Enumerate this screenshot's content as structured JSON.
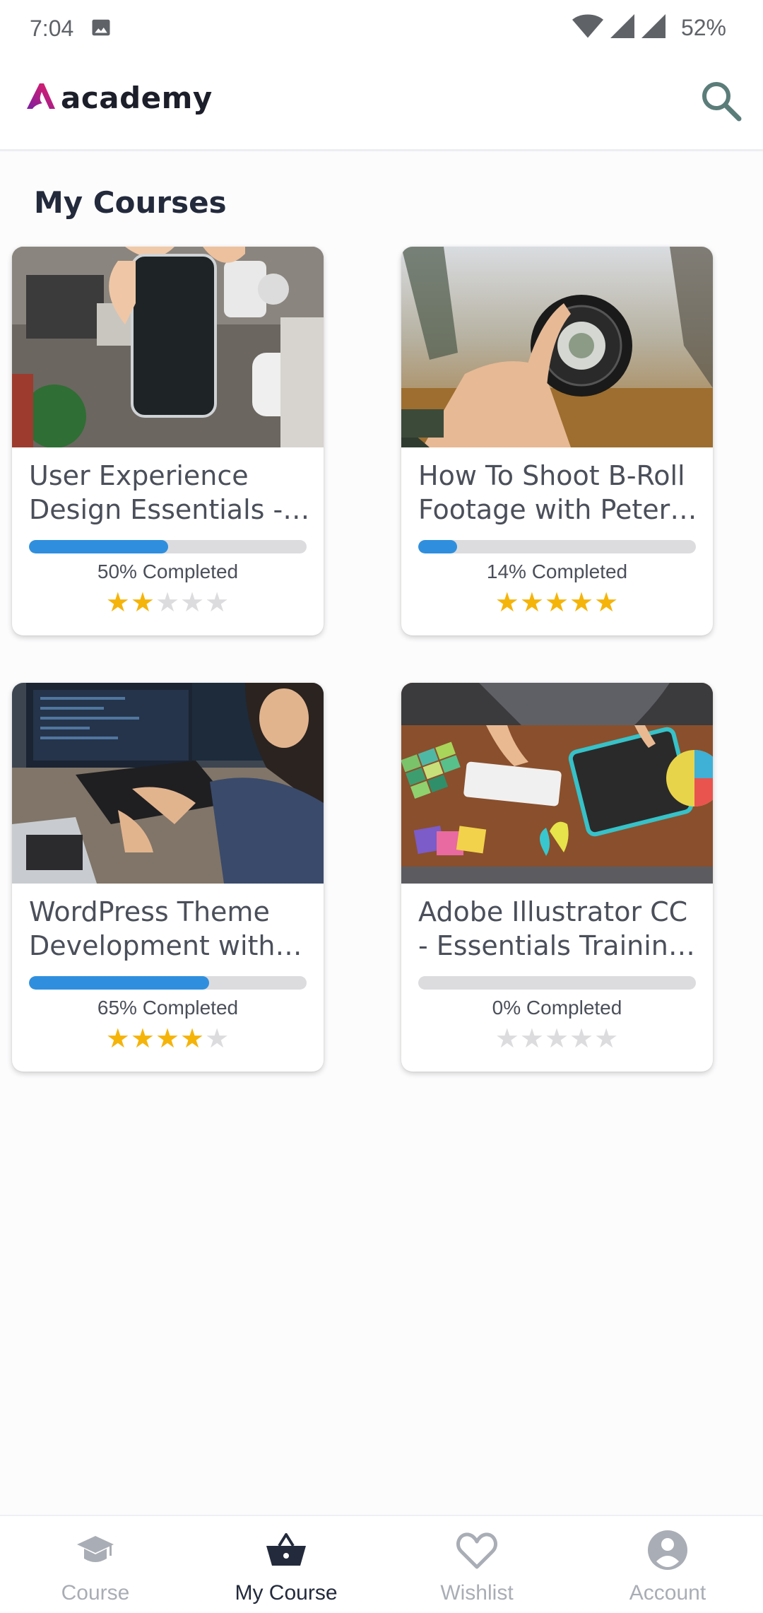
{
  "status_bar": {
    "time": "7:04",
    "battery": "52%"
  },
  "app": {
    "logo_text": "academy",
    "brand_color": "#c2185b"
  },
  "page": {
    "title": "My Courses"
  },
  "courses": [
    {
      "title": "User Experience Design Essentials - A...",
      "progress_label": "50% Completed",
      "progress": 50,
      "rating": 2
    },
    {
      "title": "How To Shoot B-Roll Footage with Peter ...",
      "progress_label": "14% Completed",
      "progress": 14,
      "rating": 5
    },
    {
      "title": "WordPress Theme Development with B...",
      "progress_label": "65% Completed",
      "progress": 65,
      "rating": 4
    },
    {
      "title": "Adobe Illustrator CC - Essentials Training ...",
      "progress_label": "0% Completed",
      "progress": 0,
      "rating": 0
    }
  ],
  "bottom_nav": [
    {
      "label": "Course",
      "icon": "graduation-cap-icon",
      "active": false
    },
    {
      "label": "My Course",
      "icon": "basket-icon",
      "active": true
    },
    {
      "label": "Wishlist",
      "icon": "heart-icon",
      "active": false
    },
    {
      "label": "Account",
      "icon": "account-circle-icon",
      "active": false
    }
  ],
  "colors": {
    "progress": "#2f8fde",
    "star": "#f5b40a",
    "star_empty": "#dcdcdf",
    "nav_active": "#232a3c",
    "nav_inactive": "#a9adb5"
  }
}
